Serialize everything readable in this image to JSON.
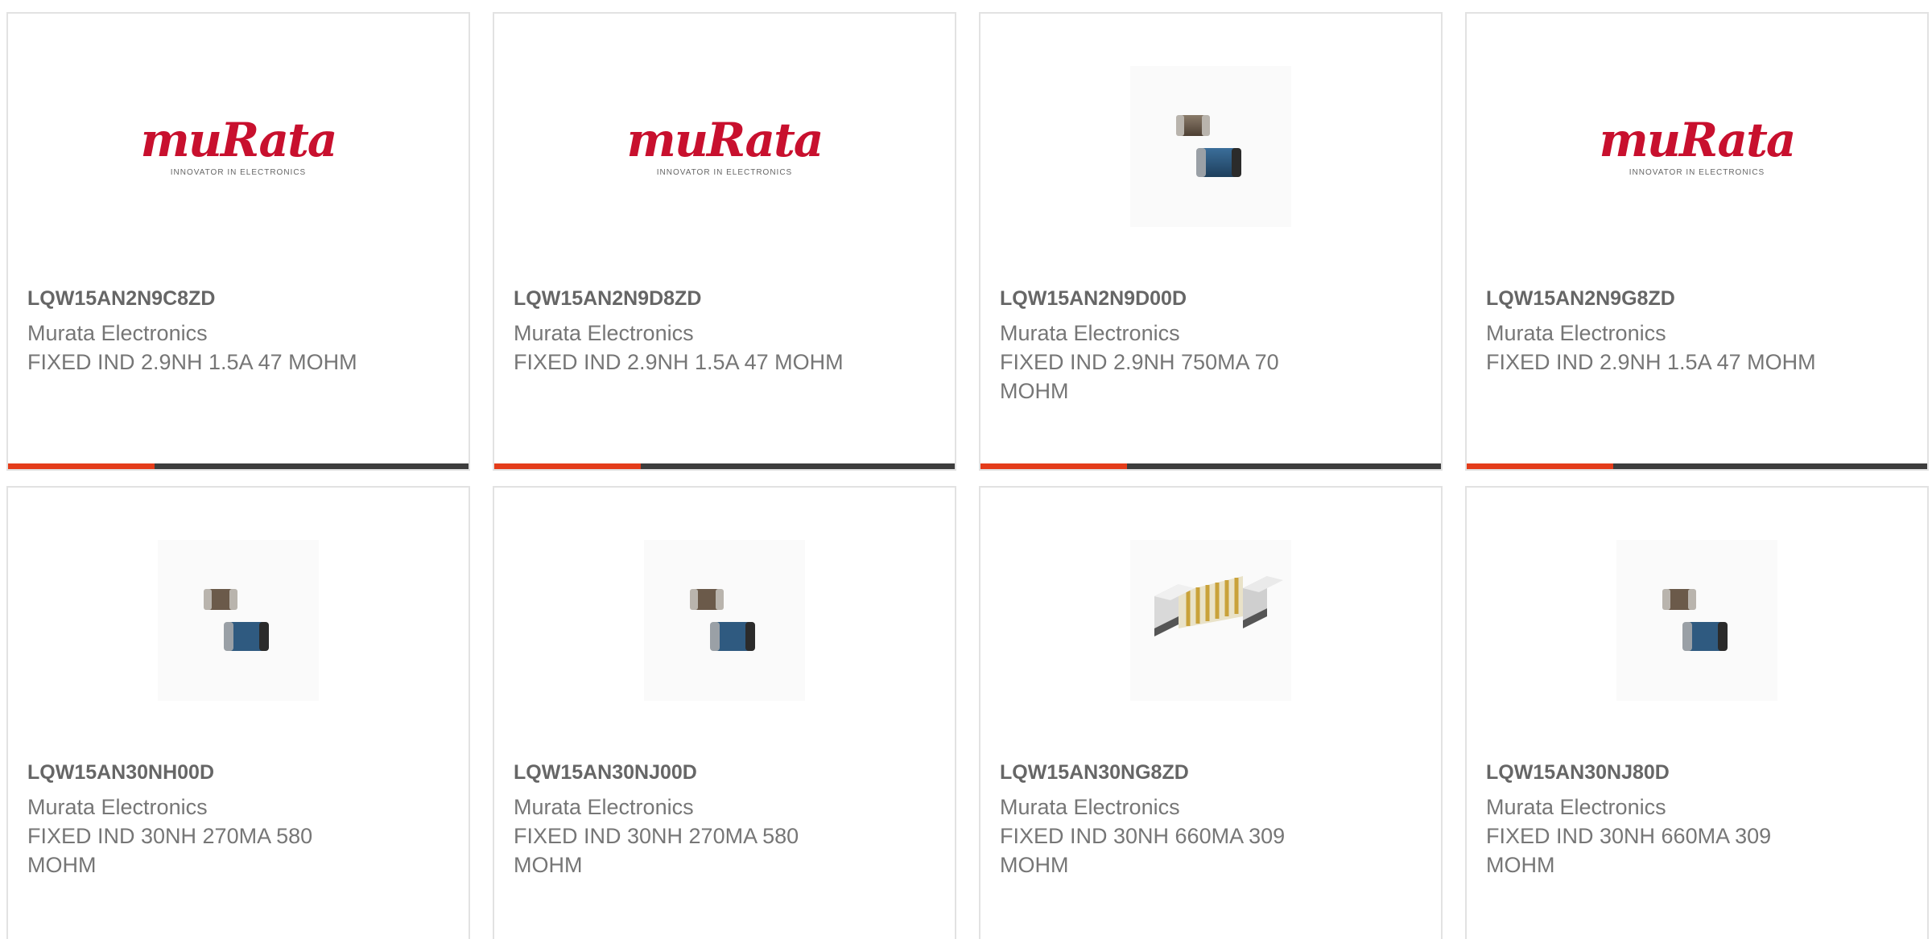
{
  "products": [
    {
      "part_number": "LQW15AN2N9C8ZD",
      "manufacturer": "Murata Electronics",
      "description": "FIXED IND 2.9NH 1.5A 47 MOHM",
      "image": "murata-logo"
    },
    {
      "part_number": "LQW15AN2N9D8ZD",
      "manufacturer": "Murata Electronics",
      "description": "FIXED IND 2.9NH 1.5A 47 MOHM",
      "image": "murata-logo"
    },
    {
      "part_number": "LQW15AN2N9D00D",
      "manufacturer": "Murata Electronics",
      "description": "FIXED IND 2.9NH 750MA 70 MOHM",
      "image": "inductor-pair-photo"
    },
    {
      "part_number": "LQW15AN2N9G8ZD",
      "manufacturer": "Murata Electronics",
      "description": "FIXED IND 2.9NH 1.5A 47 MOHM",
      "image": "murata-logo"
    },
    {
      "part_number": "LQW15AN30NH00D",
      "manufacturer": "Murata Electronics",
      "description": "FIXED IND 30NH 270MA 580 MOHM",
      "image": "inductor-pair-photo"
    },
    {
      "part_number": "LQW15AN30NJ00D",
      "manufacturer": "Murata Electronics",
      "description": "FIXED IND 30NH 270MA 580 MOHM",
      "image": "inductor-pair-photo"
    },
    {
      "part_number": "LQW15AN30NG8ZD",
      "manufacturer": "Murata Electronics",
      "description": "FIXED IND 30NH 660MA 309 MOHM",
      "image": "wirewound-inductor-photo"
    },
    {
      "part_number": "LQW15AN30NJ80D",
      "manufacturer": "Murata Electronics",
      "description": "FIXED IND 30NH 660MA 309 MOHM",
      "image": "inductor-pair-photo"
    }
  ],
  "logo": {
    "wordmark": "muRata",
    "tagline": "INNOVATOR IN ELECTRONICS"
  },
  "colors": {
    "accent": "#e43c1a",
    "bar": "#3d3d3d",
    "logo_red": "#c8102e"
  }
}
